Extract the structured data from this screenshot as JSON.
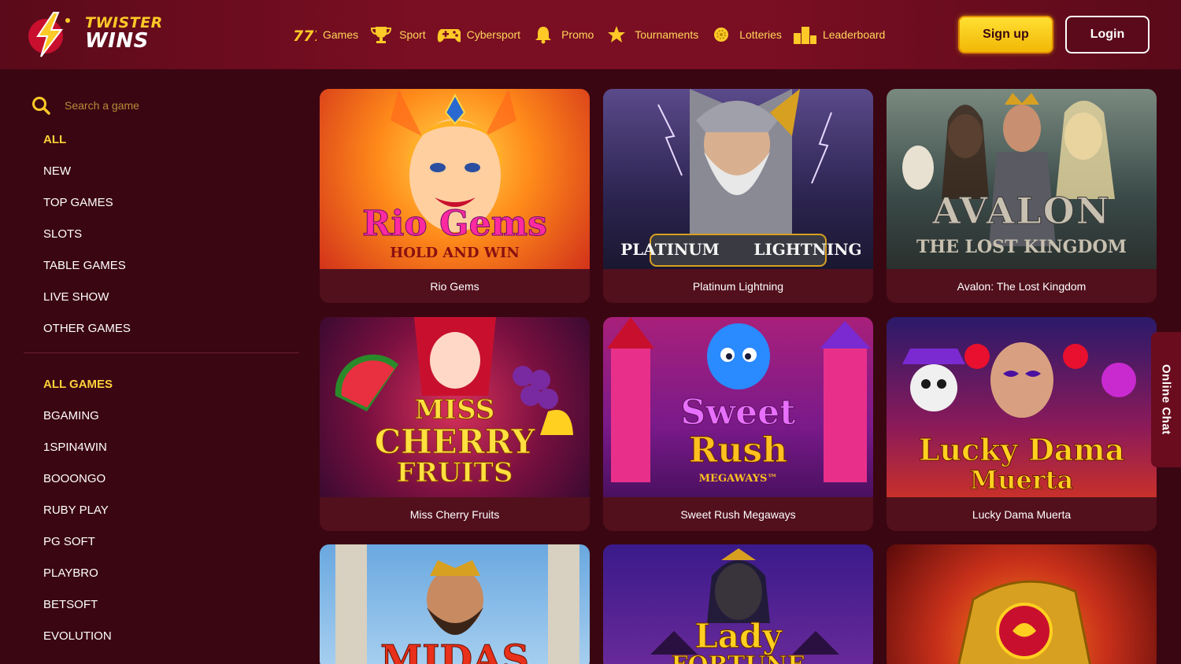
{
  "brand": {
    "line1": "TWISTER",
    "line2": "WINS"
  },
  "nav": [
    {
      "label": "Games",
      "icon": "slot-777-icon"
    },
    {
      "label": "Sport",
      "icon": "trophy-icon"
    },
    {
      "label": "Cybersport",
      "icon": "gamepad-icon"
    },
    {
      "label": "Promo",
      "icon": "bell-icon"
    },
    {
      "label": "Tournaments",
      "icon": "star-icon"
    },
    {
      "label": "Lotteries",
      "icon": "lottery-ball-icon"
    },
    {
      "label": "Leaderboard",
      "icon": "podium-icon"
    }
  ],
  "auth": {
    "signup": "Sign up",
    "login": "Login"
  },
  "search": {
    "placeholder": "Search a game"
  },
  "categories": [
    "ALL",
    "NEW",
    "TOP GAMES",
    "SLOTS",
    "TABLE GAMES",
    "LIVE SHOW",
    "OTHER GAMES"
  ],
  "providers": [
    "ALL GAMES",
    "BGAMING",
    "1SPIN4WIN",
    "BOOONGO",
    "RUBY PLAY",
    "PG SOFT",
    "PLAYBRO",
    "BETSOFT",
    "EVOLUTION"
  ],
  "games": [
    {
      "title": "Rio Gems",
      "art": [
        "Rio Gems",
        "HOLD AND WIN"
      ]
    },
    {
      "title": "Platinum Lightning",
      "art": [
        "PLATINUM",
        "LIGHTNING"
      ]
    },
    {
      "title": "Avalon: The Lost Kingdom",
      "art": [
        "AVALON",
        "THE LOST KINGDOM"
      ]
    },
    {
      "title": "Miss Cherry Fruits",
      "art": [
        "MISS",
        "CHERRY",
        "FRUITS"
      ]
    },
    {
      "title": "Sweet Rush Megaways",
      "art": [
        "Sweet",
        "Rush",
        "MEGAWAYS™"
      ]
    },
    {
      "title": "Lucky Dama Muerta",
      "art": [
        "Lucky Dama",
        "Muerta"
      ]
    },
    {
      "title": "",
      "art": [
        "MIDAS"
      ]
    },
    {
      "title": "",
      "art": [
        "Lady",
        "FORTUNE"
      ]
    },
    {
      "title": "",
      "art": []
    }
  ],
  "chat": {
    "label": "Online Chat"
  },
  "colors": {
    "accent": "#ffd23a",
    "background": "#3a0612",
    "card": "#52101c"
  }
}
